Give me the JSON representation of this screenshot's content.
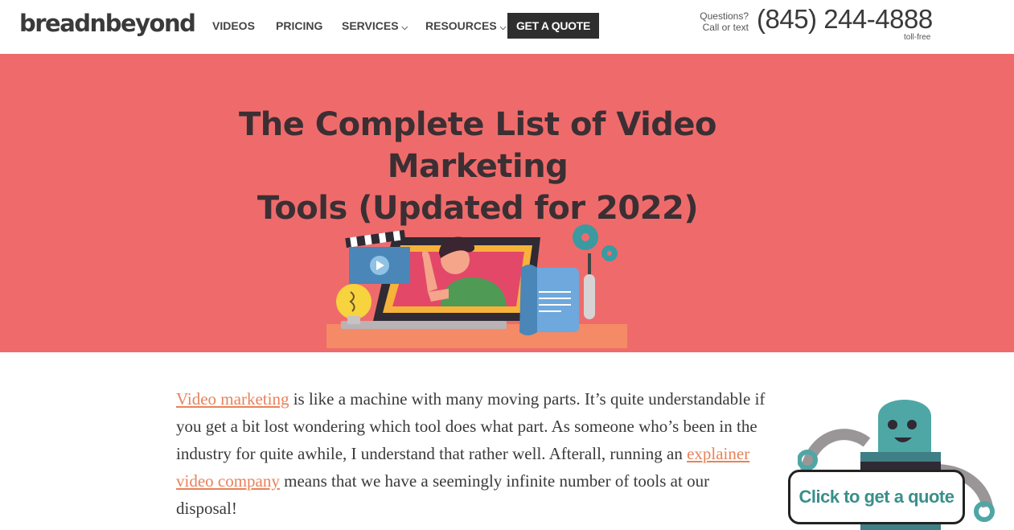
{
  "header": {
    "logo": "breadnbeyond",
    "nav": [
      {
        "label": "VIDEOS"
      },
      {
        "label": "PRICING"
      },
      {
        "label": "SERVICES",
        "chevron": "chevron-down-icon"
      },
      {
        "label": "RESOURCES",
        "chevron": "chevron-down-icon"
      }
    ],
    "quote_button": "GET A QUOTE",
    "questions_line1": "Questions?",
    "questions_line2": "Call or text",
    "phone": "(845) 244-4888",
    "toll_free": "toll-free"
  },
  "hero": {
    "title_line1": "The Complete List of Video Marketing",
    "title_line2": "Tools (Updated for 2022)",
    "background_color": "#ef6b6b"
  },
  "article": {
    "link1": "Video marketing",
    "text1": " is like a machine with many moving parts. It’s quite understandable if you get a bit lost wondering which tool does what part. As someone who’s been in the industry for quite awhile, I understand that rather well. Afterall, running an ",
    "link2": "explainer video company",
    "text2": " means that we have a seemingly infinite number of tools at our disposal!"
  },
  "cta": {
    "label": "Click to get a quote",
    "color": "#3a8f8a"
  }
}
